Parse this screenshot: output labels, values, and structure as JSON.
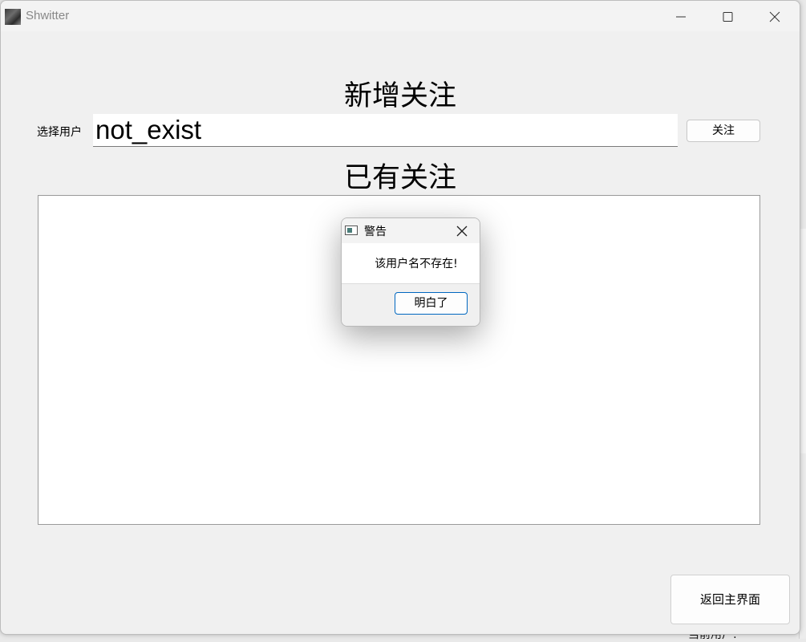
{
  "window": {
    "title": "Shwitter",
    "icon": "app-icon"
  },
  "add_follow": {
    "heading": "新增关注",
    "user_label": "选择用户",
    "user_value": "not_exist",
    "follow_label": "关注"
  },
  "existing_follow": {
    "heading": "已有关注",
    "items": []
  },
  "back_label": "返回主界面",
  "background_window": {
    "partial_text": "当前用户:"
  },
  "dialog": {
    "title": "警告",
    "message": "该用户名不存在!",
    "ok_label": "明白了",
    "accent": "#0067c0"
  }
}
